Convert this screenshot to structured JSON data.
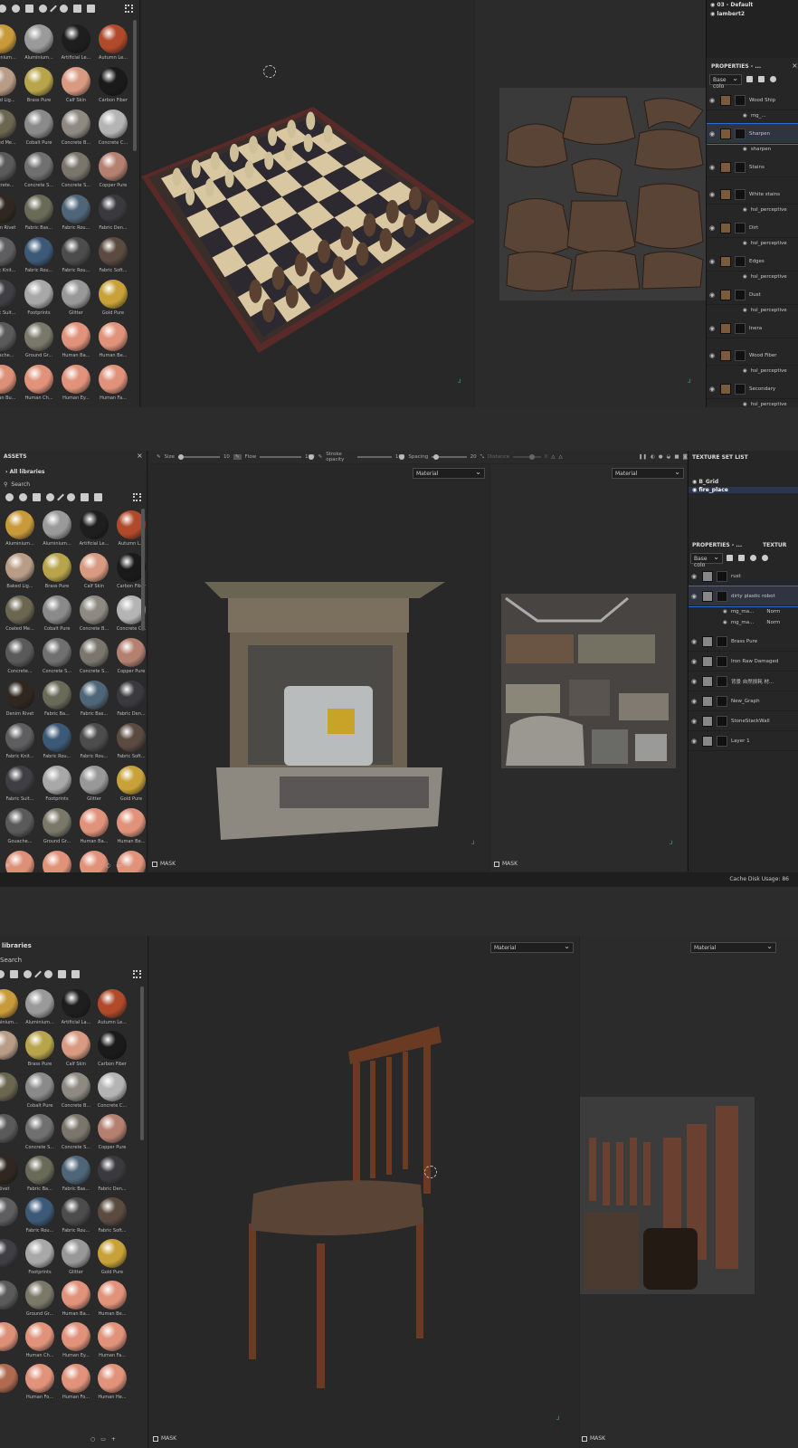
{
  "panel1": {
    "outliner": [
      "03 - Default",
      "lambert2"
    ],
    "properties_title": "PROPERTIES - ...",
    "channel": "Base colo",
    "materials": [
      {
        "label": "Aluminium...",
        "color": "#c89a3a"
      },
      {
        "label": "Aluminium...",
        "color": "#9a9a9a"
      },
      {
        "label": "Artificial Le...",
        "color": "#1e1e1e"
      },
      {
        "label": "Autumn Le...",
        "color": "#b04a2a"
      },
      {
        "label": "Baked Lig...",
        "color": "#b89c86"
      },
      {
        "label": "Brass Pure",
        "color": "#b8a44a"
      },
      {
        "label": "Calf Skin",
        "color": "#d89a80"
      },
      {
        "label": "Carbon Fiber",
        "color": "#1a1a1a"
      },
      {
        "label": "Coated Me...",
        "color": "#6a6650"
      },
      {
        "label": "Cobalt Pure",
        "color": "#8a8a8a"
      },
      {
        "label": "Concrete B...",
        "color": "#8e8a82"
      },
      {
        "label": "Concrete C...",
        "color": "#b4b4b4"
      },
      {
        "label": "Concrete...",
        "color": "#5a5a5a"
      },
      {
        "label": "Concrete S...",
        "color": "#707070"
      },
      {
        "label": "Concrete S...",
        "color": "#7a766c"
      },
      {
        "label": "Copper Pure",
        "color": "#b48070"
      },
      {
        "label": "Denim Rivet",
        "color": "#302820"
      },
      {
        "label": "Fabric Bas...",
        "color": "#6a6a58"
      },
      {
        "label": "Fabric Rou...",
        "color": "#4e6678"
      },
      {
        "label": "Fabric Den...",
        "color": "#3a3a3e"
      },
      {
        "label": "Fabric Knit...",
        "color": "#5e5e60"
      },
      {
        "label": "Fabric Rou...",
        "color": "#3c5a78"
      },
      {
        "label": "Fabric Rou...",
        "color": "#4c4c4c"
      },
      {
        "label": "Fabric Soft...",
        "color": "#5a4a40"
      },
      {
        "label": "Fabric Suit...",
        "color": "#3e3e44"
      },
      {
        "label": "Footprints",
        "color": "#a8a8a8"
      },
      {
        "label": "Glitter",
        "color": "#989898"
      },
      {
        "label": "Gold Pure",
        "color": "#c8a238"
      },
      {
        "label": "Gouache...",
        "color": "#5a5a5a"
      },
      {
        "label": "Ground Gr...",
        "color": "#7a7868"
      },
      {
        "label": "Human Ba...",
        "color": "#e0927a"
      },
      {
        "label": "Human Be...",
        "color": "#e0927a"
      },
      {
        "label": "Human Bu...",
        "color": "#dd9078"
      },
      {
        "label": "Human Ch...",
        "color": "#e0927a"
      },
      {
        "label": "Human Ey...",
        "color": "#e0927a"
      },
      {
        "label": "Human Fa...",
        "color": "#e0927a"
      },
      {
        "label": "Human Fe...",
        "color": "#b06a50"
      },
      {
        "label": "Human Fo...",
        "color": "#e0927a"
      },
      {
        "label": "Human Fo...",
        "color": "#e0927a"
      },
      {
        "label": "Human He...",
        "color": "#e0927a"
      }
    ],
    "layers": [
      {
        "name": "Wood Ship",
        "sub": "mg_..."
      },
      {
        "name": "Sharpen",
        "sub": "sharpen"
      },
      {
        "name": "Stains",
        "sub": ""
      },
      {
        "name": "White stains",
        "sub": "hsl_perceptive"
      },
      {
        "name": "Dirt",
        "sub": "hsl_perceptive"
      },
      {
        "name": "Edges",
        "sub": "hsl_perceptive"
      },
      {
        "name": "Dust",
        "sub": "hsl_perceptive"
      },
      {
        "name": "Inera",
        "sub": ""
      },
      {
        "name": "Wood Fiber",
        "sub": "hsl_perceptive"
      },
      {
        "name": "Secondary",
        "sub": "hsl_perceptive"
      }
    ]
  },
  "panel2": {
    "assets_title": "ASSETS",
    "breadcrumb": "All libraries",
    "search_placeholder": "Search",
    "toolbar": {
      "size_label": "Size",
      "size_value": "10",
      "flow_label": "Flow",
      "flow_value": "100",
      "stroke_label": "Stroke opacity",
      "stroke_value": "100",
      "spacing_label": "Spacing",
      "spacing_value": "20",
      "distance_label": "Distance",
      "distance_value": "0"
    },
    "viewport_dropdown_3d": "Material",
    "viewport_dropdown_2d": "Material",
    "mask_label": "MASK",
    "texture_set_title": "TEXTURE SET LIST",
    "texture_sets": [
      "B_Grid",
      "fire_place"
    ],
    "properties_title": "PROPERTIES - ...",
    "textures_tab": "TEXTUR",
    "channel": "Base colo",
    "layers": [
      {
        "name": "rust"
      },
      {
        "name": "dirty plastic robot",
        "subs": [
          "mg_ma...",
          "mg_ma..."
        ],
        "blend": "Norm"
      },
      {
        "name": "Brass Pure"
      },
      {
        "name": "Iron Raw Damaged"
      },
      {
        "name": "背景 自然损耗 材..."
      },
      {
        "name": "New_Graph"
      },
      {
        "name": "StoneStackWall"
      },
      {
        "name": "Layer 1"
      }
    ],
    "cache_label": "Cache Disk Usage:",
    "cache_value": "86",
    "materials": [
      {
        "label": "Aluminium...",
        "color": "#c89a3a"
      },
      {
        "label": "Aluminium...",
        "color": "#9a9a9a"
      },
      {
        "label": "Artificial Le...",
        "color": "#1e1e1e"
      },
      {
        "label": "Autumn L...",
        "color": "#b04a2a"
      },
      {
        "label": "Baked Lig...",
        "color": "#b89c86"
      },
      {
        "label": "Brass Pure",
        "color": "#b8a44a"
      },
      {
        "label": "Calf Skin",
        "color": "#d89a80"
      },
      {
        "label": "Carbon Fiber",
        "color": "#1a1a1a"
      },
      {
        "label": "Coated Me...",
        "color": "#6a6650"
      },
      {
        "label": "Cobalt Pure",
        "color": "#8a8a8a"
      },
      {
        "label": "Concrete B...",
        "color": "#8e8a82"
      },
      {
        "label": "Concrete C...",
        "color": "#b4b4b4"
      },
      {
        "label": "Concrete...",
        "color": "#5a5a5a"
      },
      {
        "label": "Concrete S...",
        "color": "#707070"
      },
      {
        "label": "Concrete S...",
        "color": "#7a766c"
      },
      {
        "label": "Copper Pure",
        "color": "#b48070"
      },
      {
        "label": "Denim Rivet",
        "color": "#302820"
      },
      {
        "label": "Fabric Ba...",
        "color": "#6a6a58"
      },
      {
        "label": "Fabric Bas...",
        "color": "#4e6678"
      },
      {
        "label": "Fabric Den...",
        "color": "#3a3a3e"
      },
      {
        "label": "Fabric Knit...",
        "color": "#5e5e60"
      },
      {
        "label": "Fabric Rou...",
        "color": "#3c5a78"
      },
      {
        "label": "Fabric Rou...",
        "color": "#4c4c4c"
      },
      {
        "label": "Fabric Soft...",
        "color": "#5a4a40"
      },
      {
        "label": "Fabric Suit...",
        "color": "#3e3e44"
      },
      {
        "label": "Footprints",
        "color": "#a8a8a8"
      },
      {
        "label": "Glitter",
        "color": "#989898"
      },
      {
        "label": "Gold Pure",
        "color": "#c8a238"
      },
      {
        "label": "Gouache...",
        "color": "#5a5a5a"
      },
      {
        "label": "Ground Gr...",
        "color": "#7a7868"
      },
      {
        "label": "Human Ba...",
        "color": "#e0927a"
      },
      {
        "label": "Human Be...",
        "color": "#e0927a"
      },
      {
        "label": "Human Bu...",
        "color": "#dd9078"
      },
      {
        "label": "Human Ch...",
        "color": "#e0927a"
      },
      {
        "label": "Human Ey...",
        "color": "#e0927a"
      },
      {
        "label": "Human Fa...",
        "color": "#e0927a"
      },
      {
        "label": "Human Fe...",
        "color": "#b06a50"
      },
      {
        "label": "Human Fo...",
        "color": "#e0927a"
      },
      {
        "label": "Human Fo...",
        "color": "#e0927a"
      },
      {
        "label": "Human He...",
        "color": "#e0927a"
      }
    ]
  },
  "panel3": {
    "breadcrumb": "libraries",
    "search_placeholder": "Search",
    "viewport_dropdown_3d": "Material",
    "viewport_dropdown_2d": "Material",
    "mask_label": "MASK",
    "materials": [
      {
        "label": "Aluminium...",
        "color": "#c89a3a"
      },
      {
        "label": "Aluminium...",
        "color": "#9a9a9a"
      },
      {
        "label": "Artificial La...",
        "color": "#1e1e1e"
      },
      {
        "label": "Autumn Le...",
        "color": "#b04a2a"
      },
      {
        "label": "",
        "color": "#b89c86"
      },
      {
        "label": "Brass Pure",
        "color": "#b8a44a"
      },
      {
        "label": "Calf Skin",
        "color": "#d89a80"
      },
      {
        "label": "Carbon Fiber",
        "color": "#1a1a1a"
      },
      {
        "label": "",
        "color": "#6a6650"
      },
      {
        "label": "Cobalt Pure",
        "color": "#8a8a8a"
      },
      {
        "label": "Concrete B...",
        "color": "#8e8a82"
      },
      {
        "label": "Concrete C...",
        "color": "#b4b4b4"
      },
      {
        "label": "",
        "color": "#5a5a5a"
      },
      {
        "label": "Concrete S...",
        "color": "#707070"
      },
      {
        "label": "Concrete S...",
        "color": "#7a766c"
      },
      {
        "label": "Copper Pure",
        "color": "#b48070"
      },
      {
        "label": "Rivet",
        "color": "#302820"
      },
      {
        "label": "Fabric Ba...",
        "color": "#6a6a58"
      },
      {
        "label": "Fabric Bas...",
        "color": "#4e6678"
      },
      {
        "label": "Fabric Den...",
        "color": "#3a3a3e"
      },
      {
        "label": "",
        "color": "#5e5e60"
      },
      {
        "label": "Fabric Rou...",
        "color": "#3c5a78"
      },
      {
        "label": "Fabric Rou...",
        "color": "#4c4c4c"
      },
      {
        "label": "Fabric Soft...",
        "color": "#5a4a40"
      },
      {
        "label": "",
        "color": "#3e3e44"
      },
      {
        "label": "Footprints",
        "color": "#a8a8a8"
      },
      {
        "label": "Glitter",
        "color": "#989898"
      },
      {
        "label": "Gold Pure",
        "color": "#c8a238"
      },
      {
        "label": "",
        "color": "#5a5a5a"
      },
      {
        "label": "Ground Gr...",
        "color": "#7a7868"
      },
      {
        "label": "Human Ba...",
        "color": "#e0927a"
      },
      {
        "label": "Human Be...",
        "color": "#e0927a"
      },
      {
        "label": "",
        "color": "#dd9078"
      },
      {
        "label": "Human Ch...",
        "color": "#e0927a"
      },
      {
        "label": "Human Ey...",
        "color": "#e0927a"
      },
      {
        "label": "Human Fa...",
        "color": "#e0927a"
      },
      {
        "label": "",
        "color": "#b06a50"
      },
      {
        "label": "Human Fo...",
        "color": "#e0927a"
      },
      {
        "label": "Human Fo...",
        "color": "#e0927a"
      },
      {
        "label": "Human He...",
        "color": "#e0927a"
      }
    ]
  }
}
